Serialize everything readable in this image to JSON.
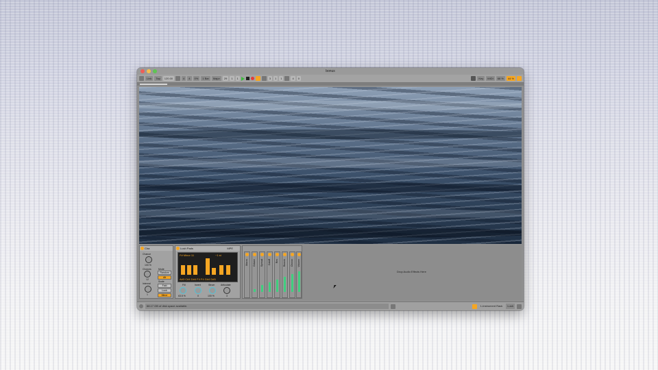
{
  "window": {
    "title": "bonus"
  },
  "toolbar": {
    "link": "Link",
    "tap": "Tap",
    "tempo": "120.00",
    "sig_num": "4",
    "sig_den": "4",
    "metro": "0%",
    "quant": "1 Bar",
    "key": "Major",
    "position": "29",
    "beat": "1",
    "sub": "1",
    "loop_start": "3",
    "loop_b": "1",
    "loop_c": "1",
    "loop_len": "4",
    "loop_len_b": "0",
    "key_btn": "Key",
    "midi": "MIDI",
    "cpu": "68 %",
    "zoom": "44 %"
  },
  "devices": {
    "chance": {
      "title": "Cha",
      "chance_label": "Chance",
      "chance_value": "100 %",
      "choices_label": "Choices",
      "choices_value": "12",
      "mode_label": "Mode",
      "mode_value": "Random",
      "alt_label": "Alt",
      "scale_label": "Scale",
      "scale_value": "Minor",
      "interval_label": "Interval",
      "interval_value": "1",
      "btn1": "Fold",
      "btn2": "Lock"
    },
    "lush": {
      "title": "Lush Pads",
      "mpe": "MPE",
      "chord_name": "F# Minor 11",
      "voice_count": "~1 st",
      "chord_notes": "A#3 C#4 D#4 F4 F4 G#4 D#5",
      "fill_label": "Fill",
      "fill_value": "63.5 %",
      "invert_label": "Invert",
      "invert_value": "0",
      "strum_label": "Strum",
      "strum_value": "100 %",
      "articulate_label": "Articulate",
      "articulate_value": "3"
    },
    "macros": [
      "Macro",
      "Octave",
      "Spread",
      "Cutoff",
      "Res",
      "Reverb",
      "Chorus",
      "Volume"
    ],
    "drop_hint": "Drop Audio Effects Here"
  },
  "status": {
    "message": "68.17 GB of disk space available.",
    "track": "1-Instrument Rack",
    "mode": "Lush"
  }
}
